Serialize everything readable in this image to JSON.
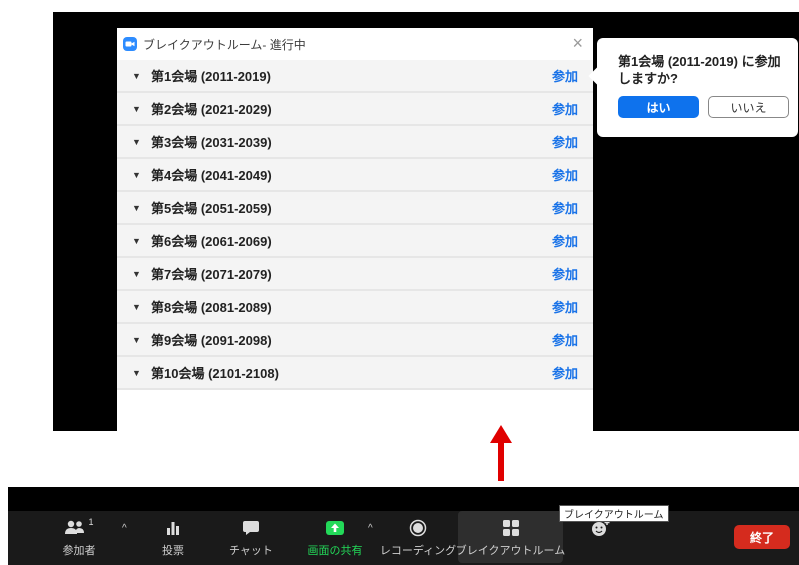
{
  "breakout_window": {
    "title": "ブレイクアウトルーム- 進行中",
    "close": "×",
    "join_label": "参加",
    "rooms": [
      "第1会場 (2011-2019)",
      "第2会場 (2021-2029)",
      "第3会場 (2031-2039)",
      "第4会場 (2041-2049)",
      "第5会場 (2051-2059)",
      "第6会場 (2061-2069)",
      "第7会場 (2071-2079)",
      "第8会場 (2081-2089)",
      "第9会場 (2091-2098)",
      "第10会場 (2101-2108)"
    ]
  },
  "confirm_popover": {
    "message": "第1会場 (2011-2019) に参加しますか?",
    "yes_label": "はい",
    "no_label": "いいえ"
  },
  "toolbar": {
    "participants_label": "参加者",
    "participants_count": "1",
    "polls_label": "投票",
    "chat_label": "チャット",
    "share_label": "画面の共有",
    "record_label": "レコーディング",
    "breakout_label": "ブレイクアウトルーム",
    "end_label": "終了",
    "tooltip": "ブレイクアウトルーム"
  },
  "colors": {
    "accent_blue": "#0e72ed",
    "join_blue": "#1a73e8",
    "share_green": "#23d959",
    "end_red": "#d52b1e",
    "arrow_red": "#e00000"
  }
}
